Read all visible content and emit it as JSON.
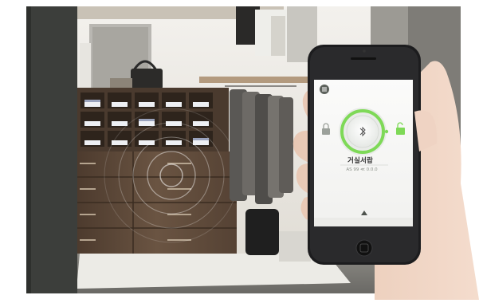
{
  "colors": {
    "accent_green": "#7ed957",
    "phone_body": "#1c1c1e",
    "wall_left": "#3b3d3a",
    "cabinet": "#5a4636",
    "rug": "#e9e7e2"
  },
  "icons": {
    "menu": "hamburger-menu-icon",
    "lock_closed": "lock-closed-icon",
    "lock_open": "lock-open-icon",
    "bluetooth": "bluetooth-icon",
    "share": "share-icon",
    "expand": "chevron-up-icon"
  },
  "phone_app": {
    "device_name": "거실서랍",
    "status_line": "AS 99 ≪ 0.0.0"
  }
}
